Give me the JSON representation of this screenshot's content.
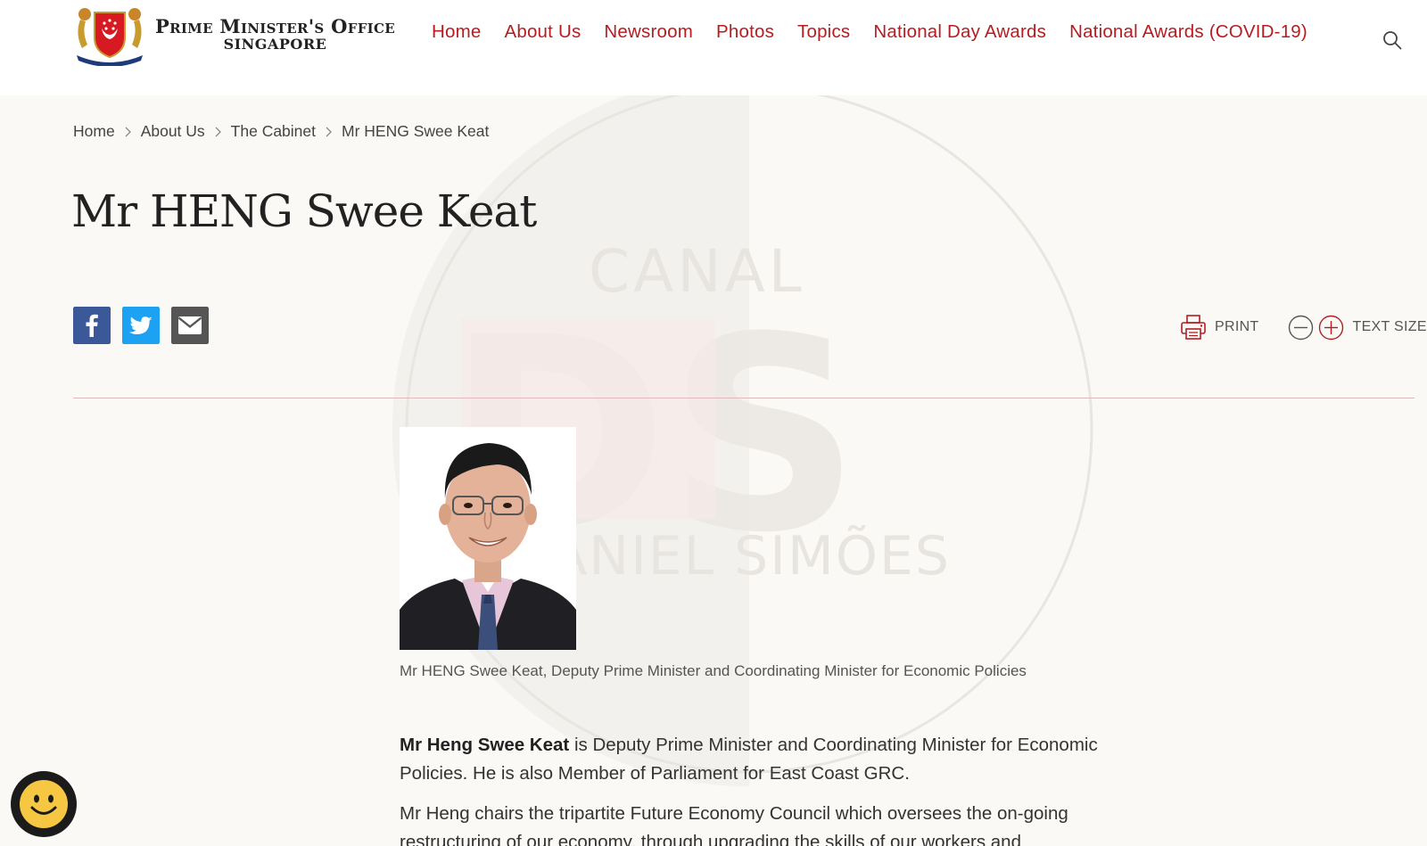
{
  "header": {
    "logo": {
      "line1": "Prime Minister's Office",
      "line2": "SINGAPORE",
      "crest_motto": "MAJULAH SINGAPURA"
    },
    "nav": [
      {
        "label": "Home"
      },
      {
        "label": "About Us"
      },
      {
        "label": "Newsroom"
      },
      {
        "label": "Photos"
      },
      {
        "label": "Topics"
      },
      {
        "label": "National Day Awards"
      },
      {
        "label": "National Awards (COVID-19)"
      }
    ],
    "search_icon": "search-icon"
  },
  "watermark": {
    "line1": "CANAL",
    "monogram": "DS",
    "line2": "DANIEL SIMÕES"
  },
  "breadcrumb": [
    {
      "label": "Home"
    },
    {
      "label": "About Us"
    },
    {
      "label": "The Cabinet"
    },
    {
      "label": "Mr HENG Swee Keat"
    }
  ],
  "page": {
    "title": "Mr HENG Swee Keat"
  },
  "share": {
    "icons": [
      "facebook-icon",
      "twitter-icon",
      "email-icon"
    ]
  },
  "tools": {
    "print_label": "PRINT",
    "text_size_label": "TEXT SIZE"
  },
  "article": {
    "caption": "Mr HENG Swee Keat, Deputy Prime Minister and Coordinating Minister for Economic Policies",
    "p1_strong": "Mr Heng Swee Keat",
    "p1_rest": " is Deputy Prime Minister and Coordinating Minister for Economic Policies. He is also Member of Parliament for East Coast GRC.",
    "p2": "Mr Heng chairs the tripartite Future Economy Council which oversees the on-going restructuring of our economy, through upgrading the skills of our workers and"
  },
  "colors": {
    "accent": "#b51d21",
    "facebook": "#3b5998",
    "twitter": "#1da1f2",
    "email": "#555555",
    "background": "#faf9f6"
  }
}
